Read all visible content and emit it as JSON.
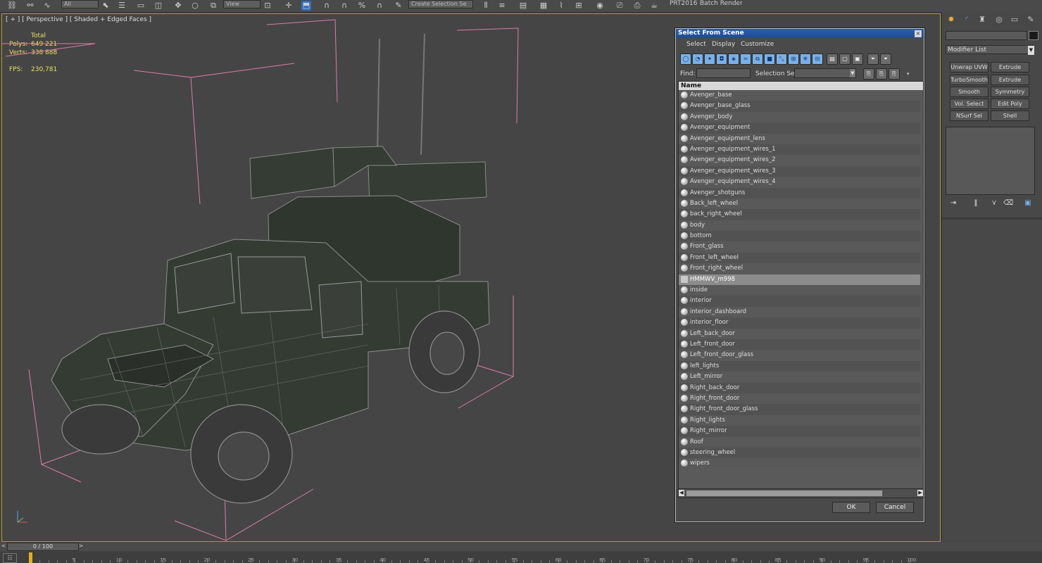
{
  "toolbar": {
    "all_filter": "All",
    "view_dropdown": "View",
    "selection_set": "Create Selection Se",
    "prt_label": "PRT2016",
    "batch_render": "Batch Render..."
  },
  "viewport": {
    "label": "[ + ] [ Perspective ] [ Shaded + Edged Faces ]",
    "stats": {
      "total_label": "Total",
      "polys_label": "Polys:",
      "polys_value": "649 221",
      "verts_label": "Verts:",
      "verts_value": "338 888",
      "fps_label": "FPS:",
      "fps_value": "230,781"
    }
  },
  "dialog": {
    "title": "Select From Scene",
    "close": "×",
    "menu": [
      "Select",
      "Display",
      "Customize"
    ],
    "find_label": "Find:",
    "find_value": "",
    "selection_set_label": "Selection Set:",
    "selection_set_value": "",
    "column_name": "Name",
    "items": [
      "Avenger_base",
      "Avenger_base_glass",
      "Avenger_body",
      "Avenger_equipment",
      "Avenger_equipment_lens",
      "Avenger_equipment_wires_1",
      "Avenger_equipment_wires_2",
      "Avenger_equipment_wires_3",
      "Avenger_equipment_wires_4",
      "Avenger_shotguns",
      "Back_left_wheel",
      "back_right_wheel",
      "body",
      "bottom",
      "Front_glass",
      "Front_left_wheel",
      "Front_right_wheel",
      "HMMWV_m998",
      "inside",
      "interior",
      "interior_dashboard",
      "interior_floor",
      "Left_back_door",
      "Left_front_door",
      "Left_front_door_glass",
      "left_lights",
      "Left_mirror",
      "Right_back_door",
      "Right_front_door",
      "Right_front_door_glass",
      "Right_lights",
      "Right_mirror",
      "Roof",
      "steering_wheel",
      "wipers"
    ],
    "selected_item": "HMMWV_m998",
    "ok": "OK",
    "cancel": "Cancel"
  },
  "command_panel": {
    "modifier_list": "Modifier List",
    "modifiers": [
      "Unwrap UVW",
      "Extrude",
      "TurboSmooth",
      "Extrude",
      "Smooth",
      "Symmetry",
      "Vol. Select",
      "Edit Poly",
      "NSurf Sel",
      "Shell"
    ]
  },
  "timeline": {
    "slider": "0 / 100",
    "ticks": [
      "5",
      "10",
      "15",
      "20",
      "25",
      "30",
      "35",
      "40",
      "45",
      "50",
      "55",
      "60",
      "65",
      "70",
      "75",
      "80",
      "85",
      "90",
      "95",
      "100"
    ]
  },
  "colors": {
    "viewport_border": "#b5942a",
    "stats_text": "#e8e060",
    "bbox_lines": "#e07aa8",
    "dialog_title": "#2d5fa8"
  }
}
